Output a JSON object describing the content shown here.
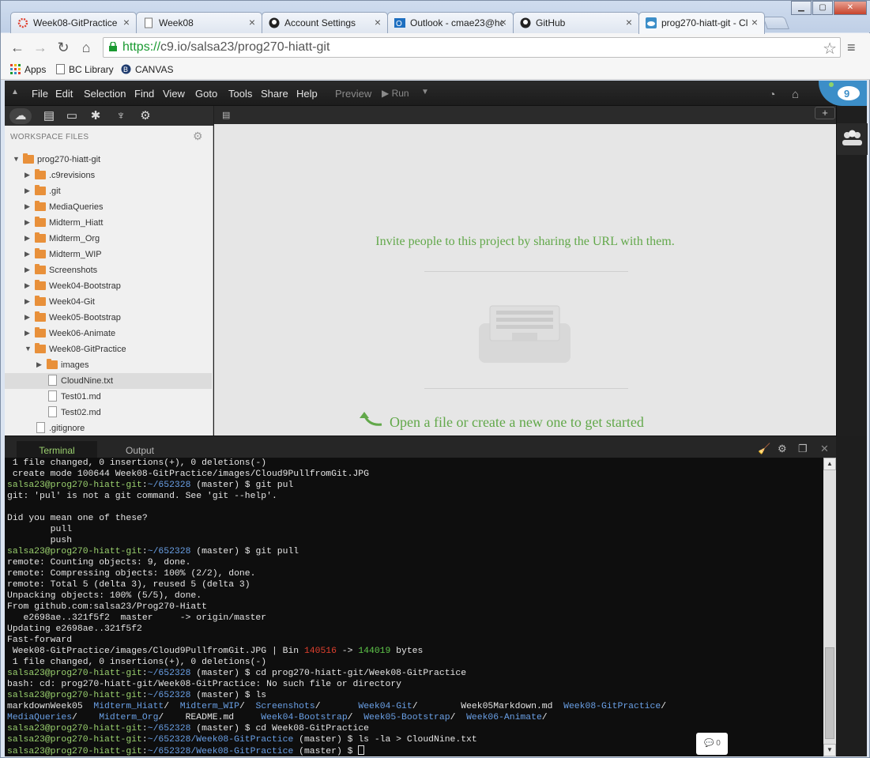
{
  "browser": {
    "tabs": [
      {
        "title": "Week08-GitPractice",
        "icon": "c9-red-icon"
      },
      {
        "title": "Week08",
        "icon": "page-icon"
      },
      {
        "title": "Account Settings",
        "icon": "github-icon"
      },
      {
        "title": "Outlook - cmae23@hc",
        "icon": "outlook-icon"
      },
      {
        "title": "GitHub",
        "icon": "github-icon"
      },
      {
        "title": "prog270-hiatt-git - Cl",
        "icon": "c9-cloud-icon",
        "active": true
      }
    ],
    "url_https": "https://",
    "url_rest": "c9.io/salsa23/prog270-hiatt-git",
    "bookmarks": [
      "Apps",
      "BC Library",
      "CANVAS"
    ]
  },
  "ide": {
    "menu": [
      "File",
      "Edit",
      "Selection",
      "Find",
      "View",
      "Goto",
      "Tools",
      "Share",
      "Help"
    ],
    "preview": "Preview",
    "run": "Run",
    "workspace_title": "WORKSPACE FILES",
    "tree": [
      {
        "label": "prog270-hiatt-git",
        "type": "folder",
        "depth": 0,
        "open": true
      },
      {
        "label": ".c9revisions",
        "type": "folder",
        "depth": 1
      },
      {
        "label": ".git",
        "type": "folder",
        "depth": 1
      },
      {
        "label": "MediaQueries",
        "type": "folder",
        "depth": 1
      },
      {
        "label": "Midterm_Hiatt",
        "type": "folder",
        "depth": 1
      },
      {
        "label": "Midterm_Org",
        "type": "folder",
        "depth": 1
      },
      {
        "label": "Midterm_WIP",
        "type": "folder",
        "depth": 1
      },
      {
        "label": "Screenshots",
        "type": "folder",
        "depth": 1
      },
      {
        "label": "Week04-Bootstrap",
        "type": "folder",
        "depth": 1
      },
      {
        "label": "Week04-Git",
        "type": "folder",
        "depth": 1
      },
      {
        "label": "Week05-Bootstrap",
        "type": "folder",
        "depth": 1
      },
      {
        "label": "Week06-Animate",
        "type": "folder",
        "depth": 1
      },
      {
        "label": "Week08-GitPractice",
        "type": "folder",
        "depth": 1,
        "open": true
      },
      {
        "label": "images",
        "type": "folder",
        "depth": 2
      },
      {
        "label": "CloudNine.txt",
        "type": "file",
        "depth": 2,
        "selected": true
      },
      {
        "label": "Test01.md",
        "type": "file",
        "depth": 2
      },
      {
        "label": "Test02.md",
        "type": "file",
        "depth": 2
      },
      {
        "label": ".gitignore",
        "type": "file",
        "depth": 1
      }
    ],
    "invite_text": "Invite people to this project by sharing the URL with them.",
    "open_text": "Open a file or create a new one to get started",
    "terminal_tab": "Terminal",
    "output_tab": "Output",
    "chat_count": "0"
  },
  "terminal_lines": [
    [
      {
        "t": " 1 file changed, 0 insertions(+), 0 deletions(-)"
      }
    ],
    [
      {
        "t": " create mode 100644 Week08-GitPractice/images/Cloud9PullfromGit.JPG"
      }
    ],
    [
      {
        "t": "salsa23@prog270-hiatt-git",
        "c": "prompt"
      },
      {
        "t": ":",
        "c": ""
      },
      {
        "t": "~/652328",
        "c": "path"
      },
      {
        "t": " (master) $ git pul"
      }
    ],
    [
      {
        "t": "git: 'pul' is not a git command. See 'git --help'."
      }
    ],
    [
      {
        "t": ""
      }
    ],
    [
      {
        "t": "Did you mean one of these?"
      }
    ],
    [
      {
        "t": "        pull"
      }
    ],
    [
      {
        "t": "        push"
      }
    ],
    [
      {
        "t": "salsa23@prog270-hiatt-git",
        "c": "prompt"
      },
      {
        "t": ":"
      },
      {
        "t": "~/652328",
        "c": "path"
      },
      {
        "t": " (master) $ git pull"
      }
    ],
    [
      {
        "t": "remote: Counting objects: 9, done."
      }
    ],
    [
      {
        "t": "remote: Compressing objects: 100% (2/2), done."
      }
    ],
    [
      {
        "t": "remote: Total 5 (delta 3), reused 5 (delta 3)"
      }
    ],
    [
      {
        "t": "Unpacking objects: 100% (5/5), done."
      }
    ],
    [
      {
        "t": "From github.com:salsa23/Prog270-Hiatt"
      }
    ],
    [
      {
        "t": "   e2698ae..321f5f2  master     -> origin/master"
      }
    ],
    [
      {
        "t": "Updating e2698ae..321f5f2"
      }
    ],
    [
      {
        "t": "Fast-forward"
      }
    ],
    [
      {
        "t": " Week08-GitPractice/images/Cloud9PullfromGit.JPG | Bin "
      },
      {
        "t": "140516",
        "c": "red"
      },
      {
        "t": " -> "
      },
      {
        "t": "144019",
        "c": "green"
      },
      {
        "t": " bytes"
      }
    ],
    [
      {
        "t": " 1 file changed, 0 insertions(+), 0 deletions(-)"
      }
    ],
    [
      {
        "t": "salsa23@prog270-hiatt-git",
        "c": "prompt"
      },
      {
        "t": ":"
      },
      {
        "t": "~/652328",
        "c": "path"
      },
      {
        "t": " (master) $ cd prog270-hiatt-git/Week08-GitPractice"
      }
    ],
    [
      {
        "t": "bash: cd: prog270-hiatt-git/Week08-GitPractice: No such file or directory"
      }
    ],
    [
      {
        "t": "salsa23@prog270-hiatt-git",
        "c": "prompt"
      },
      {
        "t": ":"
      },
      {
        "t": "~/652328",
        "c": "path"
      },
      {
        "t": " (master) $ ls"
      }
    ],
    [
      {
        "t": "markdownWeek05  "
      },
      {
        "t": "Midterm_Hiatt",
        "c": "dir"
      },
      {
        "t": "/  "
      },
      {
        "t": "Midterm_WIP",
        "c": "dir"
      },
      {
        "t": "/  "
      },
      {
        "t": "Screenshots",
        "c": "dir"
      },
      {
        "t": "/       "
      },
      {
        "t": "Week04-Git",
        "c": "dir"
      },
      {
        "t": "/        Week05Markdown.md  "
      },
      {
        "t": "Week08-GitPractice",
        "c": "dir"
      },
      {
        "t": "/"
      }
    ],
    [
      {
        "t": "MediaQueries",
        "c": "dir"
      },
      {
        "t": "/    "
      },
      {
        "t": "Midterm_Org",
        "c": "dir"
      },
      {
        "t": "/    README.md     "
      },
      {
        "t": "Week04-Bootstrap",
        "c": "dir"
      },
      {
        "t": "/  "
      },
      {
        "t": "Week05-Bootstrap",
        "c": "dir"
      },
      {
        "t": "/  "
      },
      {
        "t": "Week06-Animate",
        "c": "dir"
      },
      {
        "t": "/"
      }
    ],
    [
      {
        "t": "salsa23@prog270-hiatt-git",
        "c": "prompt"
      },
      {
        "t": ":"
      },
      {
        "t": "~/652328",
        "c": "path"
      },
      {
        "t": " (master) $ cd Week08-GitPractice"
      }
    ],
    [
      {
        "t": "salsa23@prog270-hiatt-git",
        "c": "prompt"
      },
      {
        "t": ":"
      },
      {
        "t": "~/652328/Week08-GitPractice",
        "c": "path"
      },
      {
        "t": " (master) $ ls -la > CloudNine.txt"
      }
    ],
    [
      {
        "t": "salsa23@prog270-hiatt-git",
        "c": "prompt"
      },
      {
        "t": ":"
      },
      {
        "t": "~/652328/Week08-GitPractice",
        "c": "path"
      },
      {
        "t": " (master) $ "
      },
      {
        "t": "",
        "c": "cursor"
      }
    ]
  ],
  "colors": {
    "accent_green": "#62a84a",
    "prompt_green": "#9ad06e",
    "path_blue": "#6aa0e6"
  }
}
